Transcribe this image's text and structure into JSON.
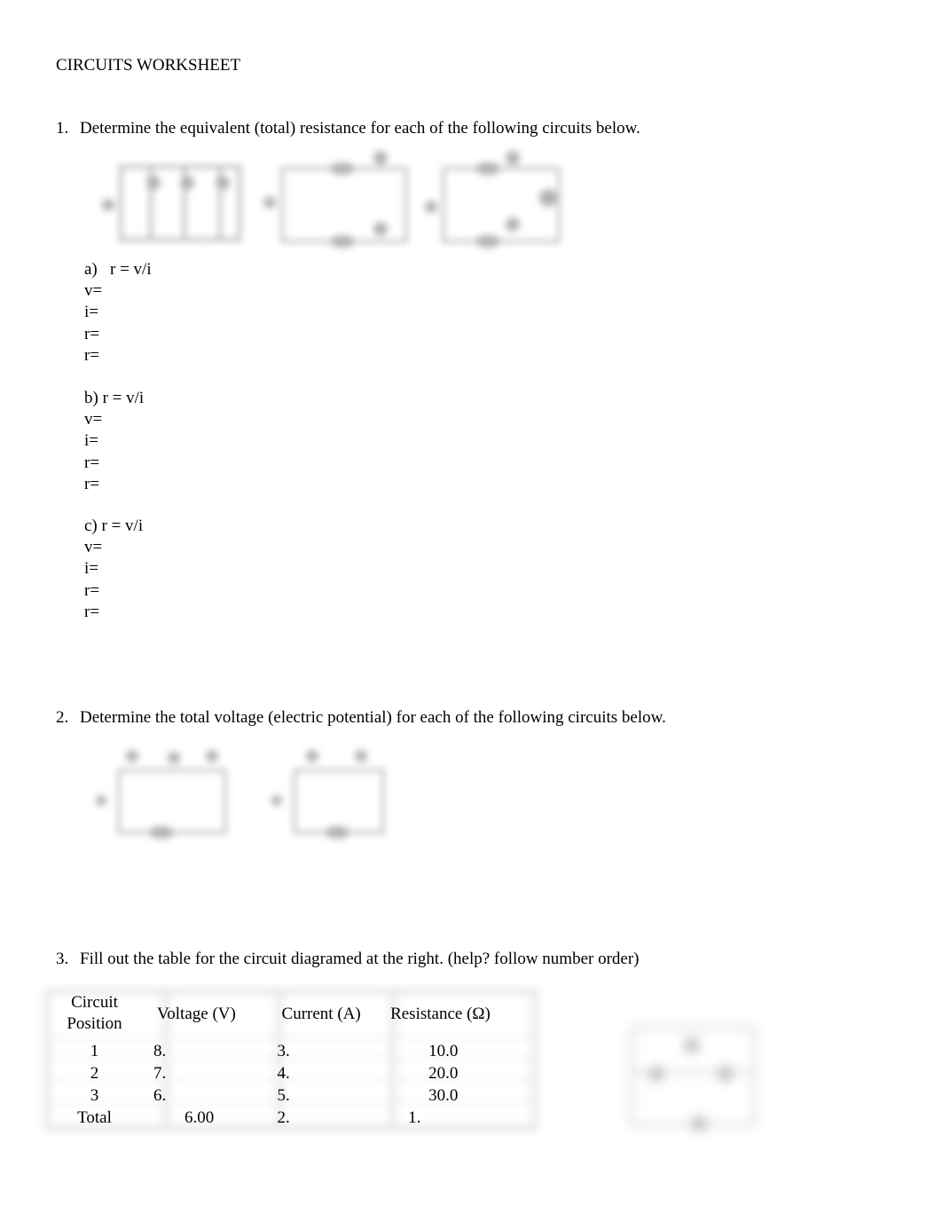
{
  "document": {
    "title": "CIRCUITS WORKSHEET"
  },
  "question1": {
    "number": "1.",
    "text": "Determine the equivalent (total) resistance for each of the following circuits below.",
    "parts": [
      {
        "header": "a)   r = v/i",
        "lines": [
          "v=",
          "i=",
          "r=",
          "r="
        ]
      },
      {
        "header": "b) r = v/i",
        "lines": [
          "v=",
          "i=",
          "r=",
          "r="
        ]
      },
      {
        "header": "c) r = v/i",
        "lines": [
          "v=",
          "i=",
          "r=",
          "r="
        ]
      }
    ],
    "diagrams": [
      "parallel-circuit-diagram",
      "series-circuit-diagram",
      "combination-circuit-diagram"
    ]
  },
  "question2": {
    "number": "2.",
    "text": "Determine the total voltage (electric potential) for each of the following circuits below.",
    "diagrams": [
      "three-resistor-circuit-diagram",
      "two-resistor-circuit-diagram"
    ]
  },
  "question3": {
    "number": "3.",
    "text": "Fill out the table for the circuit diagramed at the right. (help? follow number order)",
    "table": {
      "headers": {
        "position_line1": "Circuit",
        "position_line2": "Position",
        "voltage": "Voltage (V)",
        "current": "Current (A)",
        "resistance": "Resistance (Ω)"
      },
      "rows": [
        {
          "position": "1",
          "voltage": "8.",
          "current": "3.",
          "resistance": "10.0"
        },
        {
          "position": "2",
          "voltage": "7.",
          "current": "4.",
          "resistance": "20.0"
        },
        {
          "position": "3",
          "voltage": "6.",
          "current": "5.",
          "resistance": "30.0"
        },
        {
          "position": "Total",
          "voltage": "6.00",
          "current": "2.",
          "resistance": "1."
        }
      ]
    },
    "diagram": "table-circuit-diagram"
  }
}
